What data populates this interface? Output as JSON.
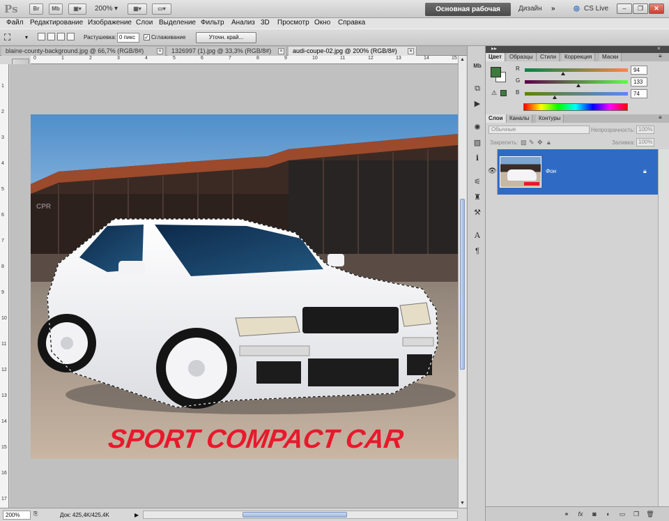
{
  "app": {
    "logo": "Ps",
    "zoom": "200%",
    "workspace": "Основная рабочая среда",
    "design_label": "Дизайн",
    "more_label": "»",
    "cs_live": "CS Live",
    "toolbar_icons": [
      "Br",
      "Mb"
    ]
  },
  "menu": [
    "Файл",
    "Редактирование",
    "Изображение",
    "Слои",
    "Выделение",
    "Фильтр",
    "Анализ",
    "3D",
    "Просмотр",
    "Окно",
    "Справка"
  ],
  "options": {
    "feather_label": "Растушевка:",
    "feather_value": "0 пикс",
    "antialias_label": "Сглаживание",
    "antialias_checked": "✓",
    "refine_button": "Уточн. край..."
  },
  "doc_tabs": [
    {
      "label": "blaine-county-background.jpg @ 66,7% (RGB/8#)"
    },
    {
      "label": "1326997 (1).jpg @ 33,3% (RGB/8#)"
    },
    {
      "label": "audi-coupe-02.jpg @ 200% (RGB/8#)"
    }
  ],
  "ruler_top": [
    "0",
    "1",
    "2",
    "3",
    "4",
    "5",
    "6",
    "7",
    "8",
    "9",
    "10",
    "11",
    "12",
    "13",
    "14",
    "15"
  ],
  "ruler_left": [
    "1",
    "2",
    "3",
    "4",
    "5",
    "6",
    "7",
    "8",
    "9",
    "10",
    "11",
    "12",
    "13",
    "14",
    "15",
    "16",
    "17"
  ],
  "canvas": {
    "watermark": "SPORT COMPACT CAR"
  },
  "status": {
    "zoom": "200%",
    "doc_size": "Док: 425,4K/425,4K"
  },
  "color_panel": {
    "tabs": [
      "Цвет",
      "Образцы",
      "Стили",
      "Коррекция",
      "Маски"
    ],
    "r_label": "R",
    "r_value": "94",
    "g_label": "G",
    "g_value": "133",
    "b_label": "B",
    "b_value": "74",
    "r_fraction": 0.37,
    "g_fraction": 0.52,
    "b_fraction": 0.29,
    "foreground": "#5e854a"
  },
  "layers_panel": {
    "tabs": [
      "Слои",
      "Каналы",
      "Контуры"
    ],
    "blend_mode": "Обычные",
    "opacity_label": "Непрозрачность:",
    "opacity_value": "100%",
    "lock_label": "Закрепить:",
    "fill_label": "Заливка:",
    "fill_value": "100%",
    "layer_name": "Фон"
  },
  "colors": {
    "selection": "#2f6bc4",
    "brand_red": "#e8192c"
  }
}
